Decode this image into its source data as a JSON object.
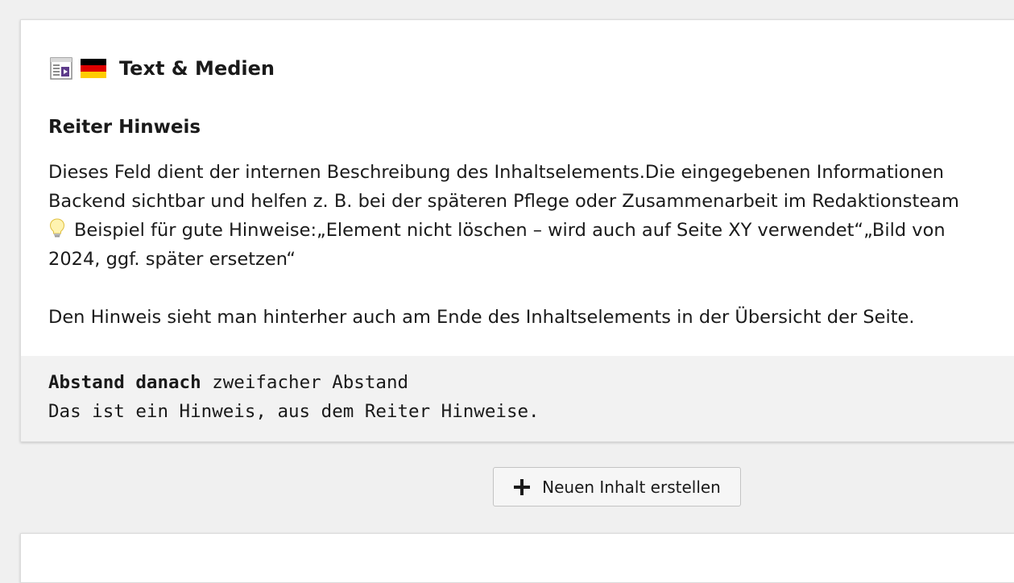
{
  "element": {
    "type_icon": "text-media-icon",
    "language_flag": "de-flag-icon",
    "title": "Text & Medien",
    "section_heading": "Reiter Hinweis",
    "description_lines": [
      "Dieses Feld dient der internen Beschreibung des Inhaltselements.Die eingegebenen Informationen",
      "Backend sichtbar und helfen z. B. bei der späteren Pflege oder Zusammenarbeit im Redaktionsteam",
      "Beispiel für gute Hinweise:„Element nicht löschen – wird auch auf Seite XY verwendet“„Bild von",
      "2024, ggf. später ersetzen“",
      "Den Hinweis sieht man hinterher auch am Ende des Inhaltselements in der Übersicht der Seite."
    ],
    "tip_icon": "lightbulb-icon",
    "footer": {
      "spacing_label": "Abstand danach",
      "spacing_value": "zweifacher Abstand",
      "note": "Das ist ein Hinweis, aus dem Reiter Hinweise."
    }
  },
  "actions": {
    "new_content_label": "Neuen Inhalt erstellen",
    "new_content_icon": "plus-icon"
  },
  "colors": {
    "page_background": "#f0f0f0",
    "card_background": "#ffffff",
    "footer_background": "#f2f2f2",
    "icon_accent": "#5d3b8a"
  }
}
